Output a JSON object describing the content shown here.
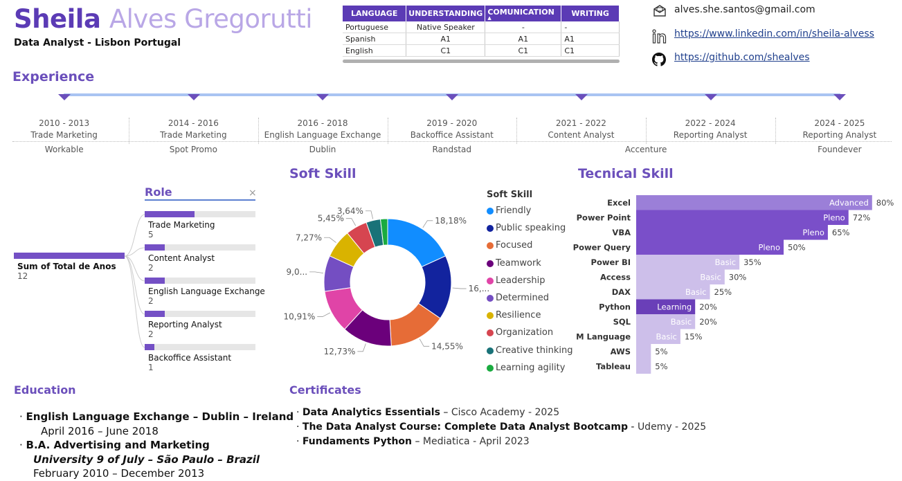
{
  "header": {
    "first_name": "Sheila",
    "last_name": "Alves Gregorutti",
    "subtitle": "Data Analyst - Lisbon Portugal"
  },
  "languages": {
    "headers": [
      "LANGUAGE",
      "UNDERSTANDING",
      "COMUNICATION",
      "WRITING"
    ],
    "rows": [
      [
        "Portuguese",
        "Native Speaker",
        "-",
        "-"
      ],
      [
        "Spanish",
        "A1",
        "A1",
        "A1"
      ],
      [
        "English",
        "C1",
        "C1",
        "C1"
      ]
    ]
  },
  "contacts": {
    "email": "alves.she.santos@gmail.com",
    "linkedin": "https://www.linkedin.com/in/sheila-alvess",
    "github": "https://github.com/shealves",
    "email_icon": "envelope-icon",
    "linkedin_icon": "linkedin-icon",
    "github_icon": "github-icon"
  },
  "experience": {
    "title": "Experience",
    "items": [
      {
        "period": "2010 - 2013",
        "role": "Trade Marketing",
        "company": "Workable"
      },
      {
        "period": "2014 - 2016",
        "role": "Trade Marketing",
        "company": "Spot Promo"
      },
      {
        "period": "2016 - 2018",
        "role": "English Language Exchange",
        "company": "Dublin"
      },
      {
        "period": "2019 - 2020",
        "role": "Backoffice Assistant",
        "company": "Randstad"
      },
      {
        "period": "2021 - 2022",
        "role": "Content Analyst",
        "company": ""
      },
      {
        "period": "2022 - 2024",
        "role": "Reporting Analyst",
        "company": "Accenture"
      },
      {
        "period": "2024 - 2025",
        "role": "Reporting Analyst",
        "company": "Foundever"
      }
    ]
  },
  "role_tree": {
    "header": "Role",
    "close_label": "×",
    "sum_label": "Sum of Total de Anos",
    "sum_value": "12",
    "sum_fraction": 1.0,
    "items": [
      {
        "label": "Trade Marketing",
        "value": "5",
        "fraction": 0.45
      },
      {
        "label": "Content Analyst",
        "value": "2",
        "fraction": 0.18
      },
      {
        "label": "English Language Exchange",
        "value": "2",
        "fraction": 0.18
      },
      {
        "label": "Reporting Analyst",
        "value": "2",
        "fraction": 0.18
      },
      {
        "label": "Backoffice Assistant",
        "value": "1",
        "fraction": 0.09
      }
    ]
  },
  "soft_skill": {
    "title": "Soft Skill",
    "legend_title": "Soft Skill"
  },
  "tech_skill": {
    "title": "Tecnical Skill"
  },
  "chart_data": [
    {
      "type": "pie",
      "title": "Soft Skill",
      "legend_title": "Soft Skill",
      "legend_placement": "right",
      "donut": true,
      "categories": [
        "Friendly",
        "Public speaking",
        "Focused",
        "Teamwork",
        "Leadership",
        "Determined",
        "Resilience",
        "Organization",
        "Creative thinking",
        "Learning agility"
      ],
      "values": [
        18.18,
        16.36,
        14.55,
        12.73,
        10.91,
        9.09,
        7.27,
        5.45,
        3.64,
        1.82
      ],
      "labels": [
        "18,18%",
        "16,...",
        "14,55%",
        "12,73%",
        "10,91%",
        "9,0...",
        "7,27%",
        "5,45%",
        "3,64%",
        ""
      ],
      "colors": [
        "#118dff",
        "#12239e",
        "#e66c37",
        "#6b007b",
        "#e044a7",
        "#744ec2",
        "#d9b300",
        "#d64550",
        "#197278",
        "#1aab40"
      ]
    },
    {
      "type": "bar",
      "orientation": "horizontal",
      "title": "Tecnical Skill",
      "categories": [
        "Excel",
        "Power Point",
        "VBA",
        "Power Query",
        "Power BI",
        "Access",
        "DAX",
        "Python",
        "SQL",
        "M Language",
        "AWS",
        "Tableau"
      ],
      "values": [
        80,
        72,
        65,
        50,
        35,
        30,
        25,
        20,
        20,
        15,
        5,
        5
      ],
      "value_labels": [
        "80%",
        "72%",
        "65%",
        "50%",
        "35%",
        "30%",
        "25%",
        "20%",
        "20%",
        "15%",
        "5%",
        "5%"
      ],
      "levels": [
        "Advanced",
        "Pleno",
        "Pleno",
        "Pleno",
        "Basic",
        "Basic",
        "Basic",
        "Learning",
        "Basic",
        "Basic",
        "",
        ""
      ],
      "level_colors": {
        "Advanced": "#9b7fd8",
        "Pleno": "#7a4fc9",
        "Basic": "#cdbfea",
        "Learning": "#6a3fb8",
        "": "#cdbfea"
      },
      "xlim": [
        0,
        100
      ]
    }
  ],
  "education": {
    "title": "Education",
    "items": [
      {
        "degree": "English Language Exchange – Dublin – Ireland",
        "dates": "April 2016 – June 2018"
      },
      {
        "degree": "B.A. Advertising and Marketing",
        "school": "University 9 of July – São Paulo – Brazil",
        "dates": "February 2010 – December 2013"
      }
    ]
  },
  "certificates": {
    "title": "Certificates",
    "items": [
      {
        "name": "Data Analytics Essentials",
        "sep": " – ",
        "issuer": "Cisco Academy - 2025"
      },
      {
        "name": "The Data Analyst Course: Complete Data Analyst Bootcamp",
        "sep": " - ",
        "issuer": "Udemy - 2025"
      },
      {
        "name": "Fundaments Python",
        "sep": " – ",
        "issuer": "Mediatica - April 2023"
      }
    ]
  }
}
